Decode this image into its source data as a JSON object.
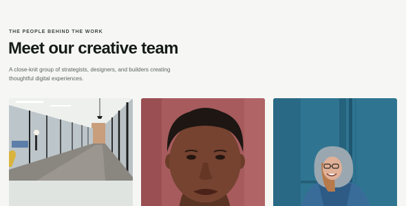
{
  "hero": {
    "eyebrow": "THE PEOPLE BEHIND THE WORK",
    "title": "Meet our creative team",
    "description": "A close-knit group of strategists, designers, and builders creating thoughtful digital experiences."
  },
  "cards": [
    {
      "image": "office-hallway-photo"
    },
    {
      "image": "portrait-woman-red-wall-photo"
    },
    {
      "image": "woman-blue-wall-hoodie-photo"
    }
  ],
  "colors": {
    "background": "#f6f7f5",
    "title": "#151b18",
    "body_text": "#5b625f"
  }
}
